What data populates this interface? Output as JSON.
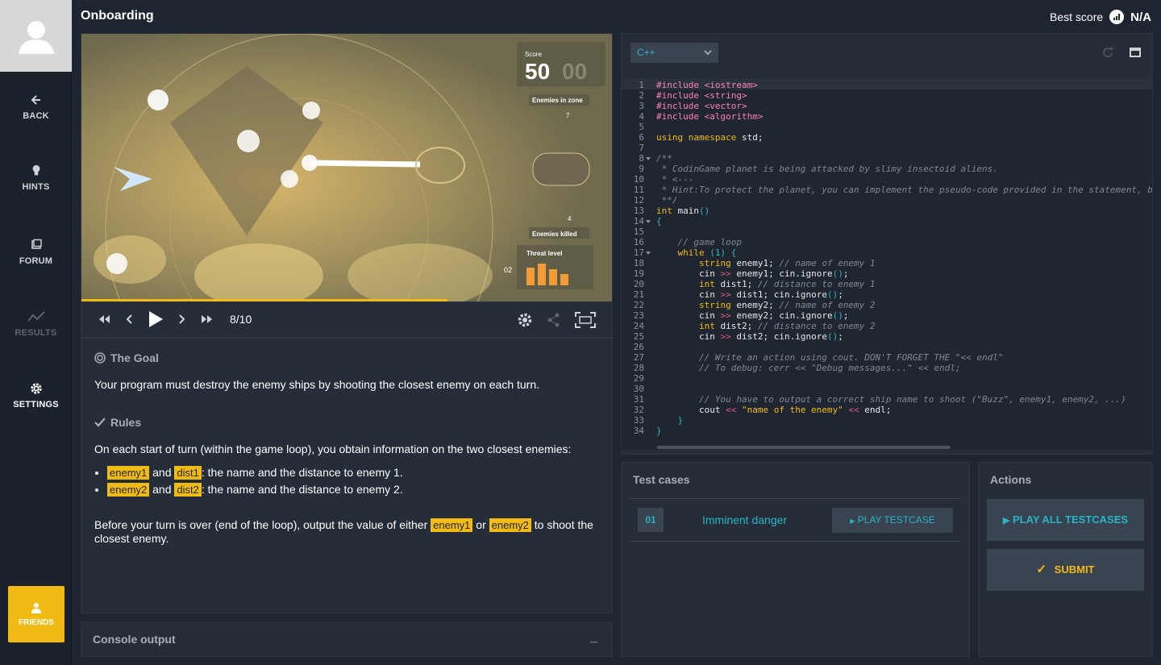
{
  "sidebar": {
    "items": [
      {
        "label": "BACK",
        "icon": "arrow-left-icon"
      },
      {
        "label": "HINTS",
        "icon": "lightbulb-icon"
      },
      {
        "label": "FORUM",
        "icon": "forum-icon"
      },
      {
        "label": "RESULTS",
        "icon": "chart-icon"
      },
      {
        "label": "SETTINGS",
        "icon": "gear-icon"
      }
    ],
    "friends": "FRIENDS"
  },
  "header": {
    "title": "Onboarding",
    "best_score_label": "Best score",
    "best_score_value": "N/A"
  },
  "game": {
    "score_label": "Score",
    "score_value": "50",
    "score_ghost": "00",
    "enemies_in_zone_label": "Enemies in zone",
    "enemies_in_zone": "7",
    "enemies_killed_label": "Enemies killed",
    "enemies_killed": "4",
    "threat_label": "Threat level",
    "threat_value": "02",
    "progress": 0.69
  },
  "player": {
    "frame": "8/10"
  },
  "statement": {
    "goal_title": "The Goal",
    "goal_text": "Your program must destroy the enemy ships by shooting the closest enemy on each turn.",
    "rules_title": "Rules",
    "rules_intro": "On each start of turn (within the game loop), you obtain information on the two closest enemies:",
    "items": [
      {
        "var1": "enemy1",
        "and": "and",
        "var2": "dist1",
        "text": ": the name and the distance to enemy 1."
      },
      {
        "var1": "enemy2",
        "and": "and",
        "var2": "dist2",
        "text": ": the name and the distance to enemy 2."
      }
    ],
    "outro_a": "Before your turn is over (end of the loop), output the value of either",
    "outro_v1": "enemy1",
    "outro_or": "or",
    "outro_v2": "enemy2",
    "outro_b": "to shoot the closest enemy."
  },
  "console": {
    "title": "Console output",
    "minimize": "_"
  },
  "editor": {
    "language": "C++"
  },
  "tests": {
    "title": "Test cases",
    "cases": [
      {
        "num": "01",
        "name": "Imminent danger",
        "play": "PLAY TESTCASE"
      }
    ]
  },
  "actions": {
    "title": "Actions",
    "play_all": "PLAY ALL TESTCASES",
    "submit": "SUBMIT"
  },
  "colors": {
    "accent": "#f2bb13",
    "cyan": "#29b4c7",
    "bg": "#1e2530",
    "panel": "#252d38"
  }
}
